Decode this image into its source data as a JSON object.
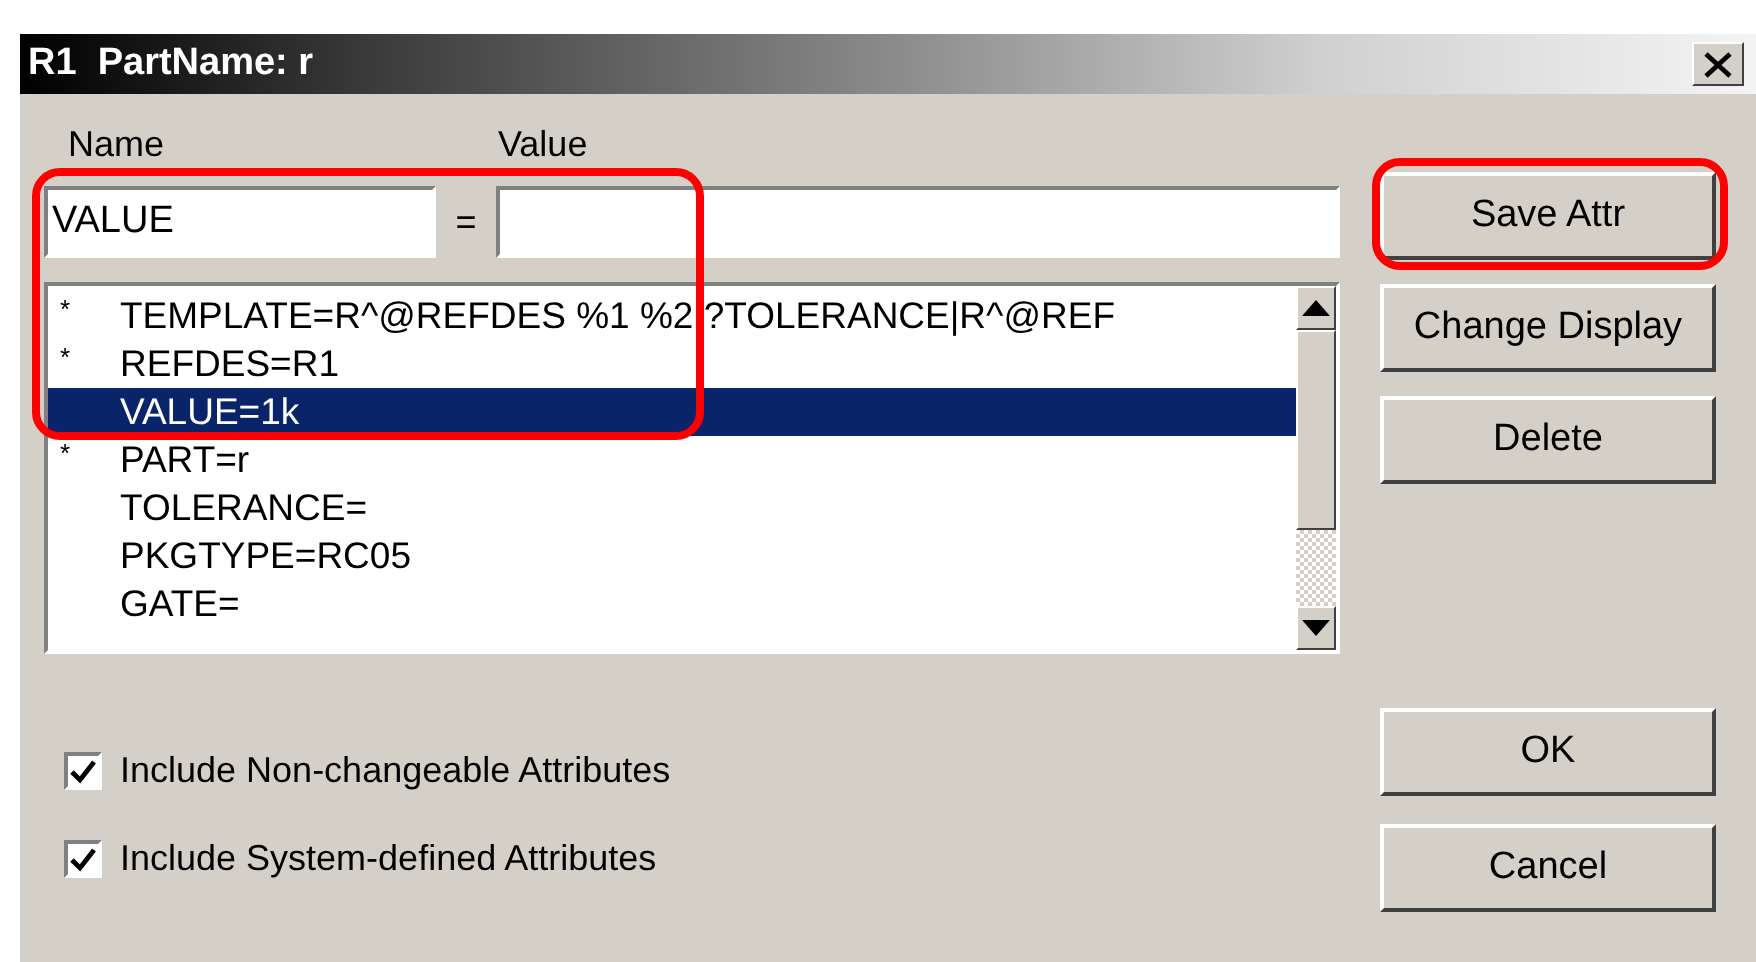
{
  "window": {
    "title": "R1  PartName: r"
  },
  "name_label": "Name",
  "value_label": "Value",
  "name_field": {
    "value": "VALUE"
  },
  "equals": "=",
  "attributes": [
    {
      "marker": "*",
      "text": "TEMPLATE=R^@REFDES %1 %2 ?TOLERANCE|R^@REF",
      "selected": false
    },
    {
      "marker": "*",
      "text": "REFDES=R1",
      "selected": false
    },
    {
      "text": "VALUE=1k",
      "selected": true
    },
    {
      "marker": "*",
      "text": "PART=r",
      "selected": false
    },
    {
      "text": "TOLERANCE=",
      "selected": false
    },
    {
      "text": "PKGTYPE=RC05",
      "selected": false
    },
    {
      "text": "GATE=",
      "selected": false
    }
  ],
  "side_buttons": [
    "Save Attr",
    "Change Display",
    "Delete"
  ],
  "options": [
    {
      "label": "Include Non-changeable Attributes",
      "checked": true
    },
    {
      "label": "Include System-defined Attributes",
      "checked": true
    }
  ],
  "dialog_buttons": [
    "OK",
    "Cancel"
  ],
  "annotation_rings": {
    "attribute_area": true,
    "save_button": true
  }
}
